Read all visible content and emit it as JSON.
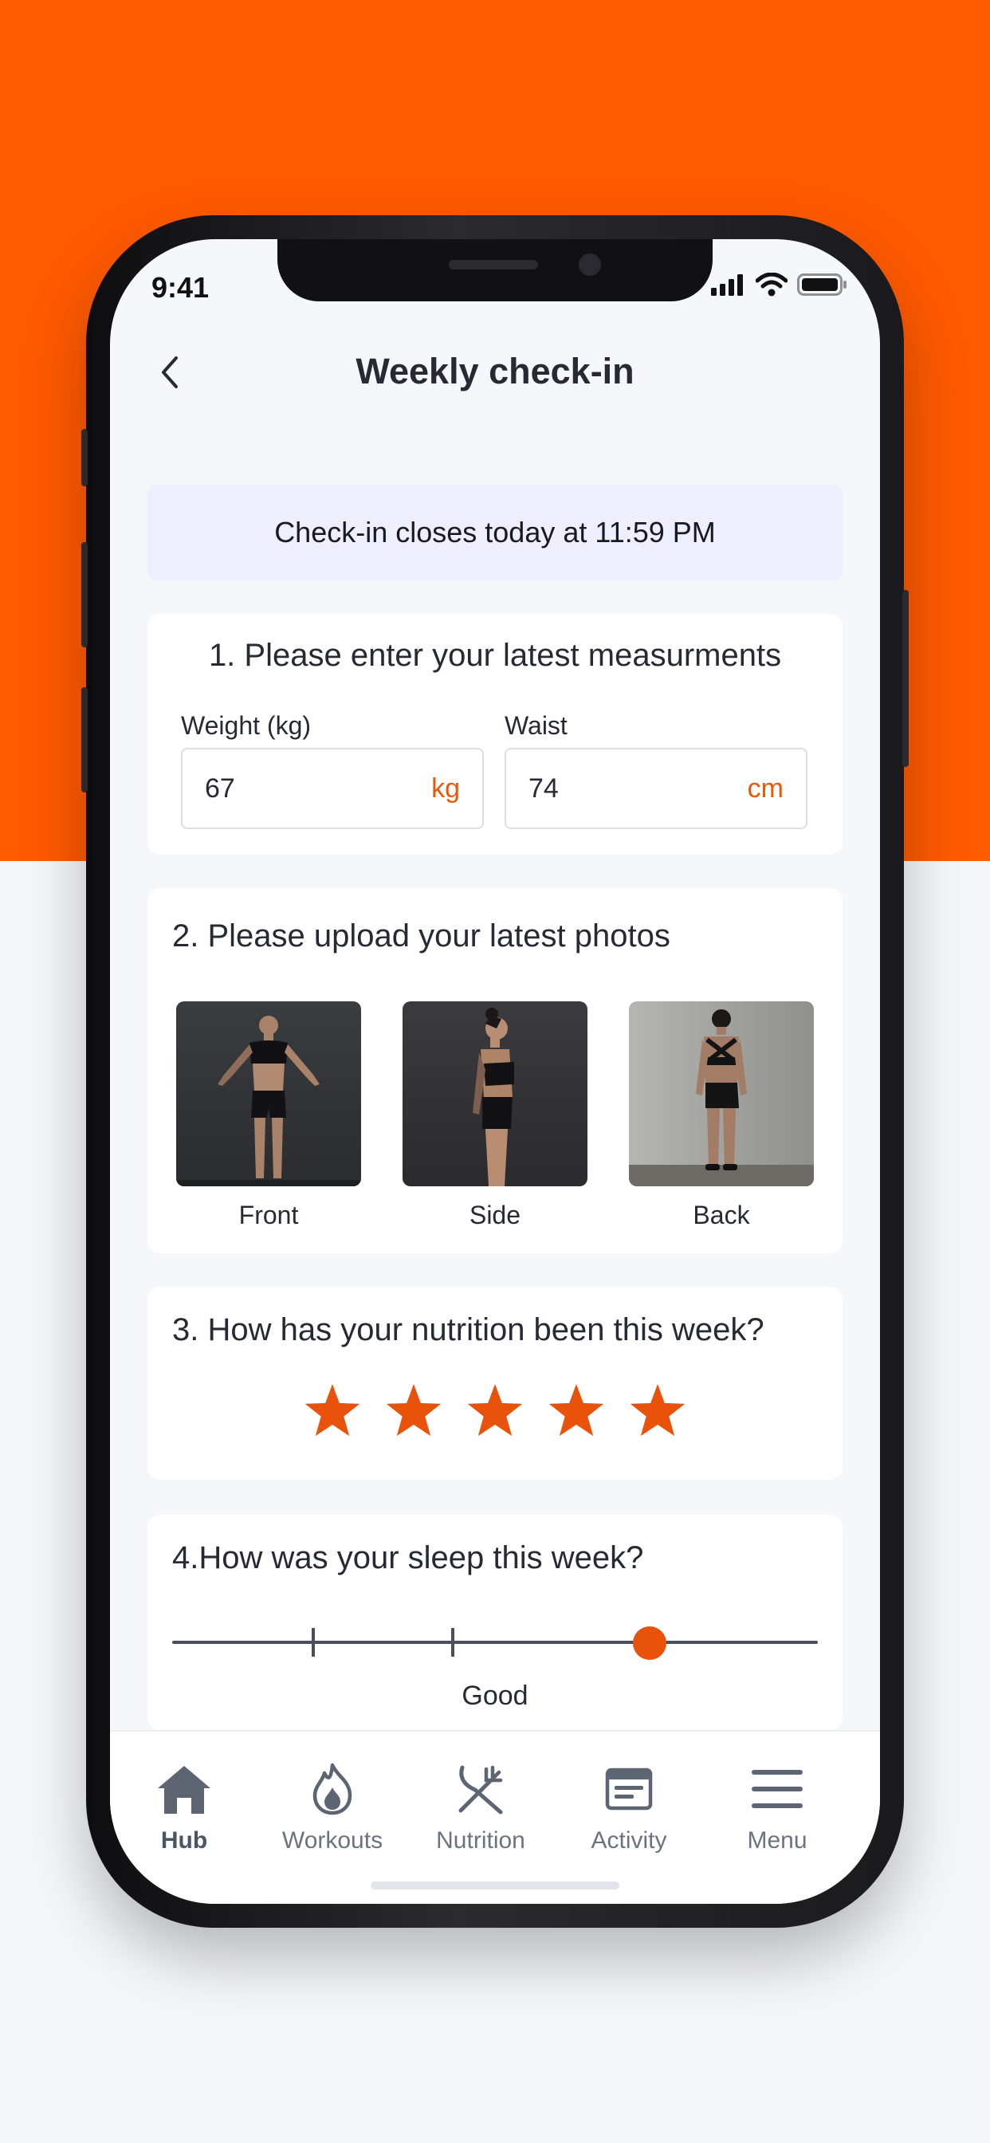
{
  "status_bar": {
    "time": "9:41"
  },
  "header": {
    "title": "Weekly check-in"
  },
  "banner": {
    "text": "Check-in closes today at 11:59 PM"
  },
  "measurements": {
    "title": "1. Please enter your latest measurments",
    "weight": {
      "label": "Weight (kg)",
      "value": "67",
      "unit": "kg"
    },
    "waist": {
      "label": "Waist",
      "value": "74",
      "unit": "cm"
    }
  },
  "photos": {
    "title": "2. Please upload your latest photos",
    "items": [
      {
        "label": "Front"
      },
      {
        "label": "Side"
      },
      {
        "label": "Back"
      }
    ]
  },
  "nutrition": {
    "title": "3. How has your nutrition been this week?",
    "rating": 5,
    "max_rating": 5
  },
  "sleep": {
    "title": "4.How was your sleep this week?",
    "level_fraction": 0.74,
    "ticks": 2,
    "value_label": "Good"
  },
  "tabs": [
    {
      "label": "Hub",
      "icon": "home-icon",
      "active": true
    },
    {
      "label": "Workouts",
      "icon": "flame-icon",
      "active": false
    },
    {
      "label": "Nutrition",
      "icon": "fork-knife-icon",
      "active": false
    },
    {
      "label": "Activity",
      "icon": "activity-card-icon",
      "active": false
    },
    {
      "label": "Menu",
      "icon": "menu-icon",
      "active": false
    }
  ],
  "colors": {
    "brand_orange": "#ff5a00",
    "accent": "#e8520a",
    "banner_bg": "#efeefc",
    "page_bg": "#f6f7fb",
    "tab_icon": "#5d6472"
  }
}
